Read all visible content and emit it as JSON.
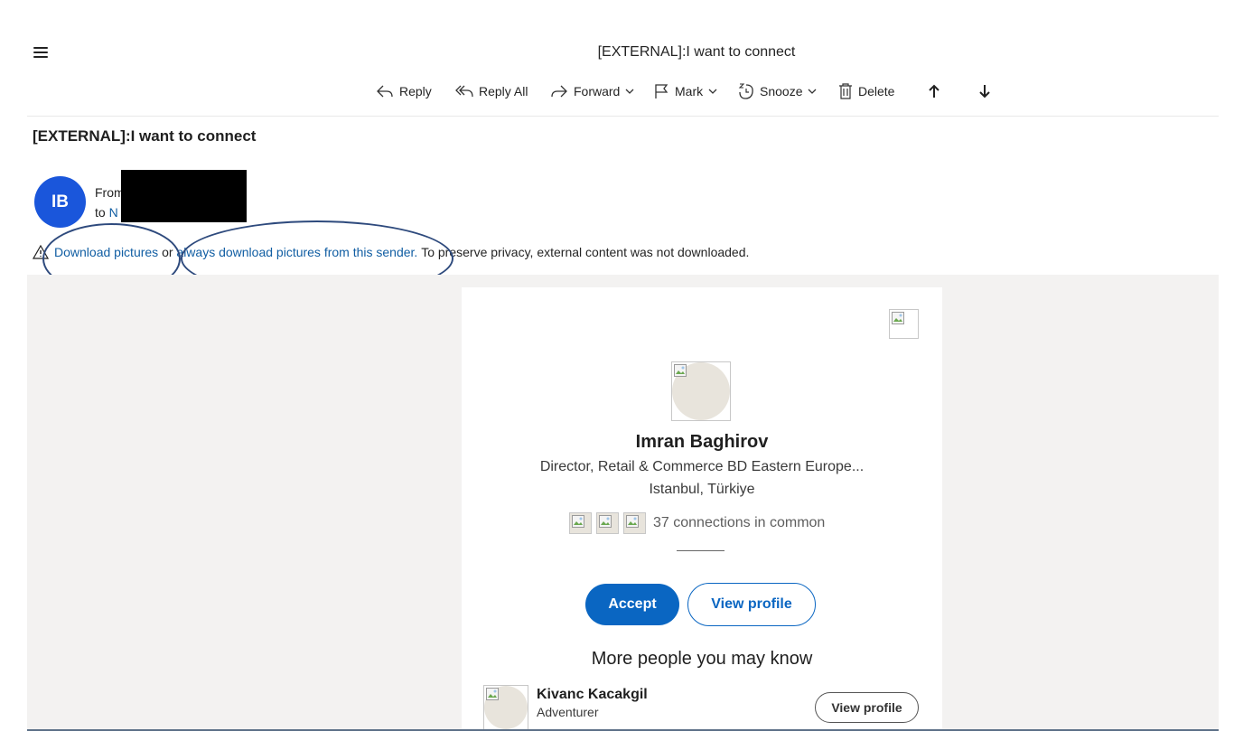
{
  "window": {
    "title": "[EXTERNAL]:I want to connect"
  },
  "toolbar": {
    "reply": "Reply",
    "reply_all": "Reply All",
    "forward": "Forward",
    "mark": "Mark",
    "snooze": "Snooze",
    "delete": "Delete"
  },
  "message": {
    "subject": "[EXTERNAL]:I want to connect",
    "avatar_initials": "IB",
    "avatar_color": "#1a56db",
    "from_label": "From",
    "to_label": "to",
    "to_partial": "N"
  },
  "notice": {
    "download_link": "Download pictures",
    "or_text": "or",
    "always_link": "always download pictures from this sender.",
    "privacy_text": "To preserve privacy, external content was not downloaded."
  },
  "email_body": {
    "profile_name": "Imran Baghirov",
    "headline": "Director, Retail & Commerce BD Eastern Europe...",
    "location": "Istanbul, Türkiye",
    "connections_text": "37 connections in common",
    "accept_label": "Accept",
    "view_profile_label": "View profile",
    "accent_color": "#0a66c2",
    "more_title": "More people you may know",
    "suggestions": [
      {
        "name": "Kivanc Kacakgil",
        "role": "Adventurer",
        "button": "View profile"
      }
    ]
  }
}
